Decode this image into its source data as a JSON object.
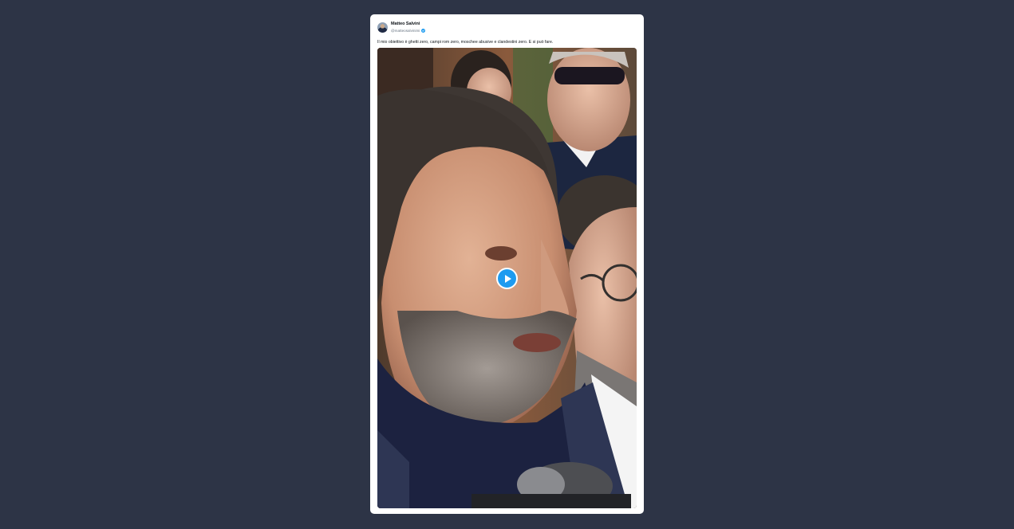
{
  "tweet": {
    "author": {
      "display_name": "Matteo Salvini",
      "handle": "@matteosalvinimi",
      "verified": true
    },
    "text": "Il mio obiettivo è ghetti zero, campi rom zero, moschee abusive e clandestini zero. E si può fare.",
    "media": {
      "type": "video",
      "play_icon": "play-icon"
    }
  },
  "colors": {
    "page_background": "#2d3446",
    "card_background": "#ffffff",
    "accent": "#1d9bf0"
  }
}
